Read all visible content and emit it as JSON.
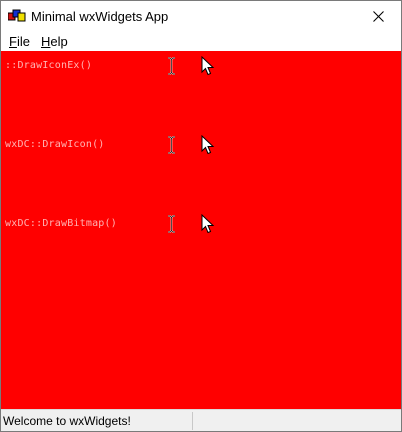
{
  "window": {
    "title": "Minimal wxWidgets App",
    "close_icon": "close-icon",
    "app_icon": "wx-app-icon"
  },
  "menubar": {
    "items": [
      {
        "label": "File",
        "mnemonic": "F"
      },
      {
        "label": "Help",
        "mnemonic": "H"
      }
    ]
  },
  "canvas": {
    "background": "#ff0000",
    "rows": [
      {
        "call": "::DrawIconEx()",
        "cursor_ibeam": "ibeam-cursor-icon",
        "cursor_arrow": "arrow-cursor-icon"
      },
      {
        "call": "wxDC::DrawIcon()",
        "cursor_ibeam": "ibeam-cursor-icon",
        "cursor_arrow": "arrow-cursor-icon"
      },
      {
        "call": "wxDC::DrawBitmap()",
        "cursor_ibeam": "ibeam-cursor-icon",
        "cursor_arrow": "arrow-cursor-icon"
      }
    ]
  },
  "statusbar": {
    "pane1": "Welcome to wxWidgets!",
    "pane2": ""
  }
}
